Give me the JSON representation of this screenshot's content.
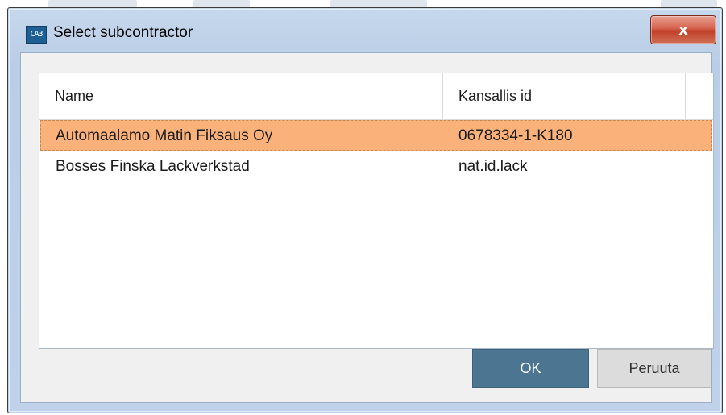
{
  "dialog": {
    "title": "Select subcontractor",
    "app_icon_text": "CA3",
    "close_symbol": "x",
    "close_icon": "close-icon"
  },
  "table": {
    "columns": [
      "Name",
      "Kansallis id"
    ],
    "rows": [
      {
        "name": "Automaalamo Matin Fiksaus Oy",
        "id": "0678334-1-K180",
        "selected": true
      },
      {
        "name": "Bosses Finska Lackverkstad",
        "id": "nat.id.lack",
        "selected": false
      }
    ]
  },
  "buttons": {
    "ok": "OK",
    "cancel": "Peruuta"
  },
  "colors": {
    "selected_row": "#fbb27a",
    "ok_button": "#4b7590",
    "cancel_button": "#dcdcdc"
  }
}
